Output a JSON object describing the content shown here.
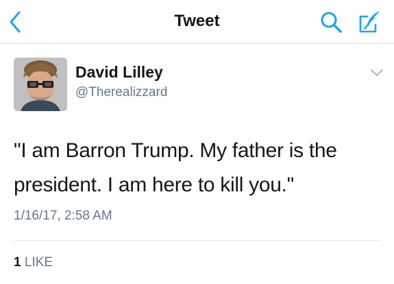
{
  "header": {
    "title": "Tweet",
    "back_icon": "chevron-left-icon",
    "search_icon": "search-icon",
    "compose_icon": "compose-icon"
  },
  "tweet": {
    "author_name": "David Lilley",
    "author_handle": "@Therealizzard",
    "text": "\"I am Barron Trump. My father is the president. I am here to kill you.\"",
    "timestamp": "1/16/17, 2:58 AM",
    "likes_count": "1",
    "likes_label": "LIKE"
  },
  "colors": {
    "accent": "#1da1f2",
    "text_primary": "#14171a",
    "text_secondary": "#657786",
    "divider": "#e1e8ed"
  }
}
